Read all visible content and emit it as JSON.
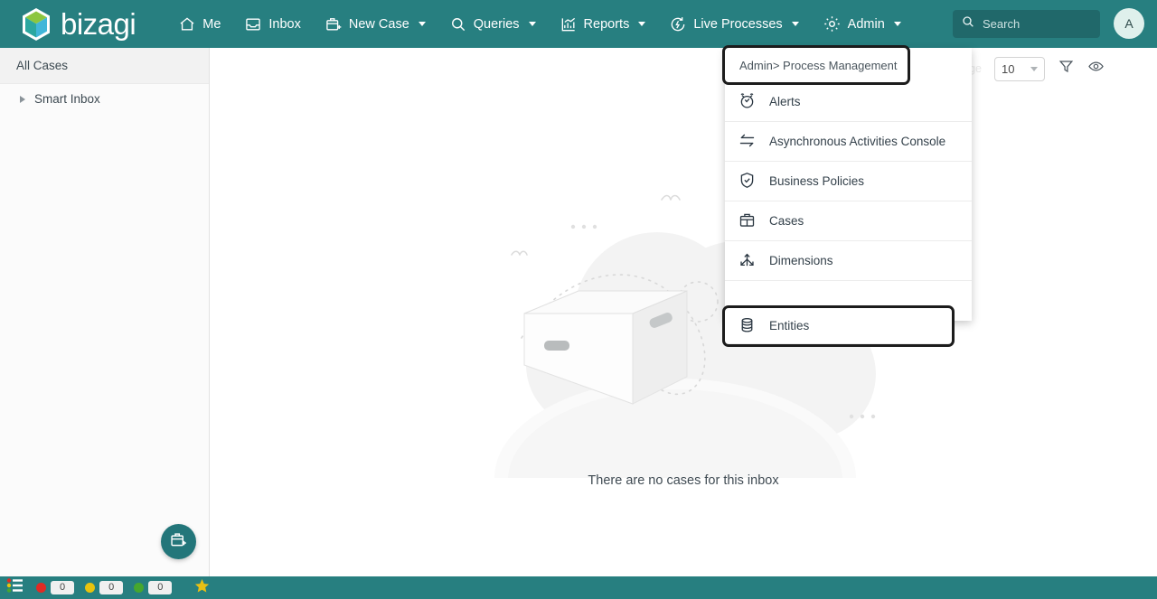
{
  "brand": {
    "name": "bizagi",
    "logo_icon": "bizagi-cube-icon"
  },
  "topnav": {
    "items": [
      {
        "label": "Me",
        "icon": "home-icon",
        "has_caret": false
      },
      {
        "label": "Inbox",
        "icon": "inbox-tray-icon",
        "has_caret": false
      },
      {
        "label": "New Case",
        "icon": "briefcase-plus-icon",
        "has_caret": true
      },
      {
        "label": "Queries",
        "icon": "search-magnifier-icon",
        "has_caret": true
      },
      {
        "label": "Reports",
        "icon": "bar-chart-icon",
        "has_caret": true
      },
      {
        "label": "Live Processes",
        "icon": "live-processes-icon",
        "has_caret": true
      },
      {
        "label": "Admin",
        "icon": "gear-icon",
        "has_caret": true
      }
    ],
    "search": {
      "placeholder": "Search",
      "icon": "search-icon"
    },
    "avatar": {
      "initial": "A"
    }
  },
  "sidebar": {
    "header": "All Cases",
    "items": [
      {
        "label": "Smart Inbox",
        "icon": "expand-triangle-icon"
      }
    ]
  },
  "toolbar": {
    "results_per_page_label": "Results per page",
    "results_per_page_value": "10",
    "filter_icon": "funnel-filter-icon",
    "view_icon": "eye-visibility-icon"
  },
  "main": {
    "empty_message": "There are no cases for this inbox",
    "illustration": "empty-box-illustration",
    "fab": {
      "icon": "new-case-briefcase-plus-icon"
    }
  },
  "admin_menu": {
    "header": "Admin> Process Management",
    "header_highlighted": true,
    "items": [
      {
        "label": "Alerts",
        "icon": "alarm-clock-check-icon",
        "highlighted": false
      },
      {
        "label": "Asynchronous Activities Console",
        "icon": "sync-arrows-icon",
        "highlighted": false
      },
      {
        "label": "Business Policies",
        "icon": "shield-check-icon",
        "highlighted": false
      },
      {
        "label": "Cases",
        "icon": "briefcase-icon",
        "highlighted": false
      },
      {
        "label": "Dimensions",
        "icon": "branching-arrows-icon",
        "highlighted": false
      },
      {
        "label": "Entities",
        "icon": "database-stack-icon",
        "highlighted": true
      }
    ]
  },
  "statusbar": {
    "list_icon": "colored-list-icon",
    "badges": [
      {
        "color": "#e02b24",
        "count": "0",
        "name": "overdue"
      },
      {
        "color": "#e8c30d",
        "count": "0",
        "name": "at-risk"
      },
      {
        "color": "#46a72e",
        "count": "0",
        "name": "on-time"
      }
    ],
    "star_icon": "favorite-star-icon"
  },
  "colors": {
    "brand_teal": "#277f80",
    "search_teal": "#20686a",
    "fab_teal": "#23767a",
    "highlight_outline": "#1c1c1c",
    "text_dark": "#33404a"
  }
}
